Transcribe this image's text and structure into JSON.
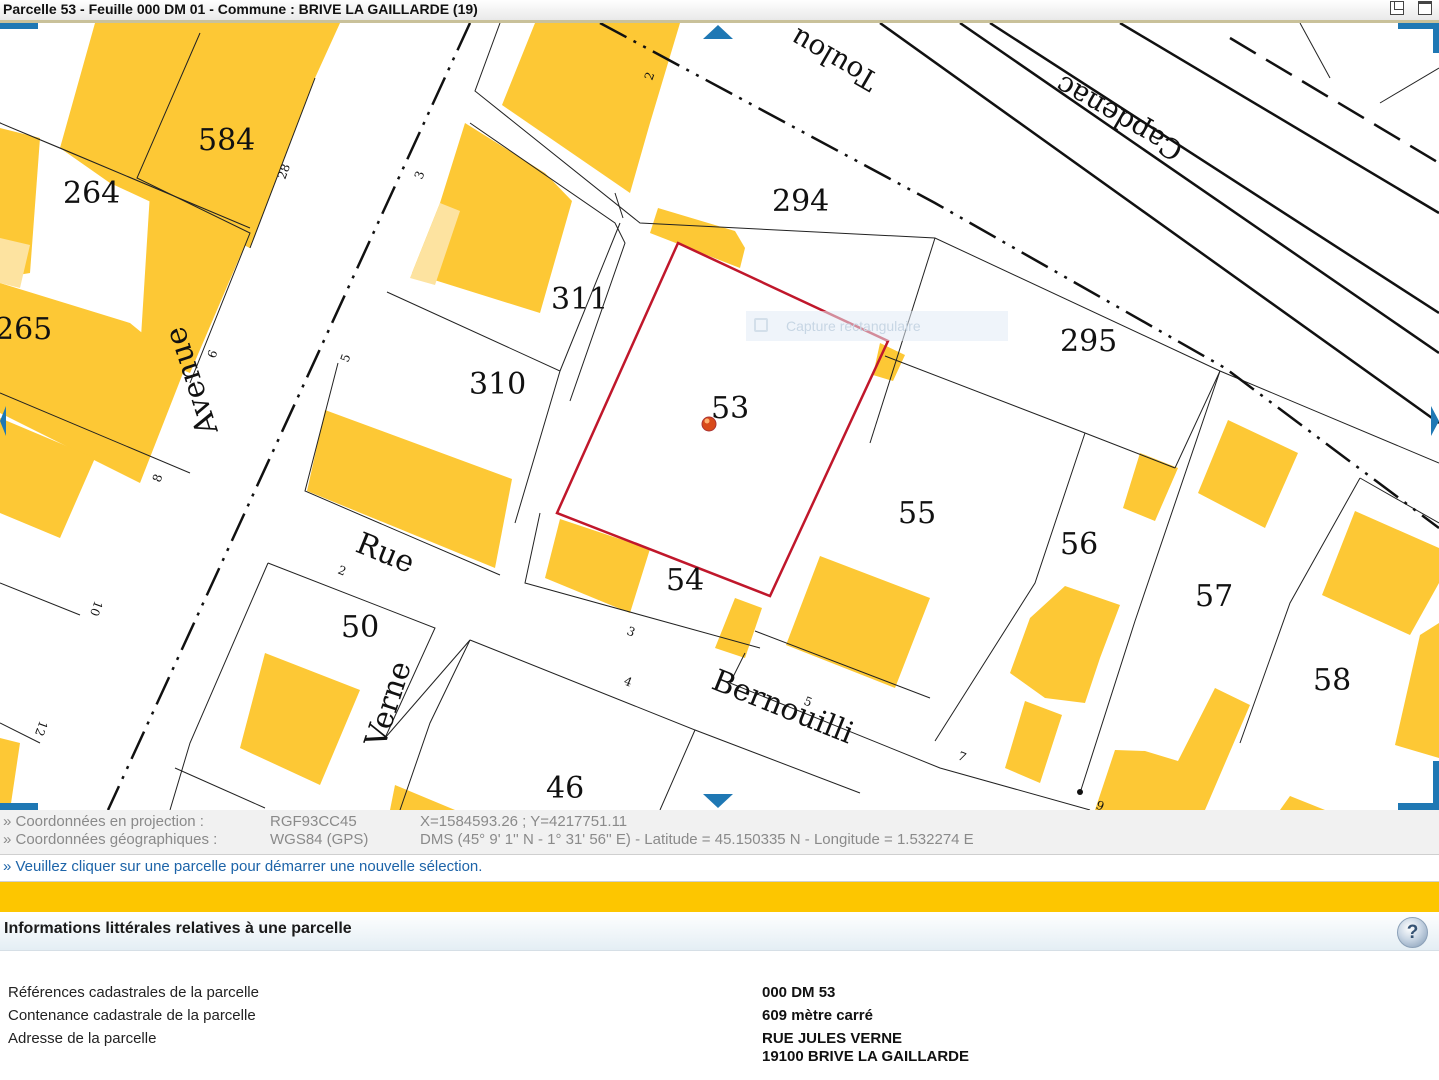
{
  "window": {
    "title": "Parcelle 53 - Feuille 000 DM 01 - Commune : BRIVE LA GAILLARDE (19)"
  },
  "map": {
    "parcel_labels": {
      "p584": "584",
      "p264": "264",
      "p265": "265",
      "p294": "294",
      "p311": "311",
      "p310": "310",
      "p295": "295",
      "p53": "53",
      "p55": "55",
      "p56": "56",
      "p57": "57",
      "p58": "58",
      "p54": "54",
      "p50": "50",
      "p46": "46"
    },
    "street_labels": {
      "avenue": "Avenue",
      "rue": "Rue",
      "verne": "Verne",
      "bernouilli": "Bernouilli",
      "toulouse": "Toulou",
      "capdenac": "Capdenac"
    },
    "house_numbers": {
      "n28": "28",
      "n3a": "3",
      "n5a": "5",
      "n6": "6",
      "n8": "8",
      "n10": "10",
      "n12": "12",
      "n2a": "2",
      "n2b": "2",
      "n3b": "3",
      "n4": "4",
      "n5b": "5",
      "n7": "7",
      "n9": "9"
    },
    "ghost_tool_label": "Capture rectangulaire",
    "colors": {
      "building": "#fdc835",
      "building_light": "#fde3a0",
      "selection": "#c0172b",
      "nav": "#1f78b4"
    }
  },
  "coordinates": {
    "projection": {
      "label": "» Coordonnées en projection :",
      "system": "RGF93CC45",
      "value": "X=1584593.26 ; Y=4217751.11"
    },
    "geographic": {
      "label": "» Coordonnées géographiques :",
      "system": "WGS84 (GPS)",
      "value": "DMS (45° 9' 1'' N - 1° 31' 56'' E) - Latitude = 45.150335 N - Longitude = 1.532274 E"
    }
  },
  "hint": "» Veuillez cliquer sur une parcelle pour démarrer une nouvelle sélection.",
  "info": {
    "header": "Informations littérales relatives à une parcelle",
    "help_icon": "help-icon",
    "rows": [
      {
        "label": "Références cadastrales de la parcelle",
        "value": "000 DM 53"
      },
      {
        "label": "Contenance cadastrale de la parcelle",
        "value": "609 mètre carré"
      },
      {
        "label": "Adresse de la parcelle",
        "value": "RUE JULES VERNE",
        "value2": "19100 BRIVE LA GAILLARDE"
      }
    ]
  }
}
